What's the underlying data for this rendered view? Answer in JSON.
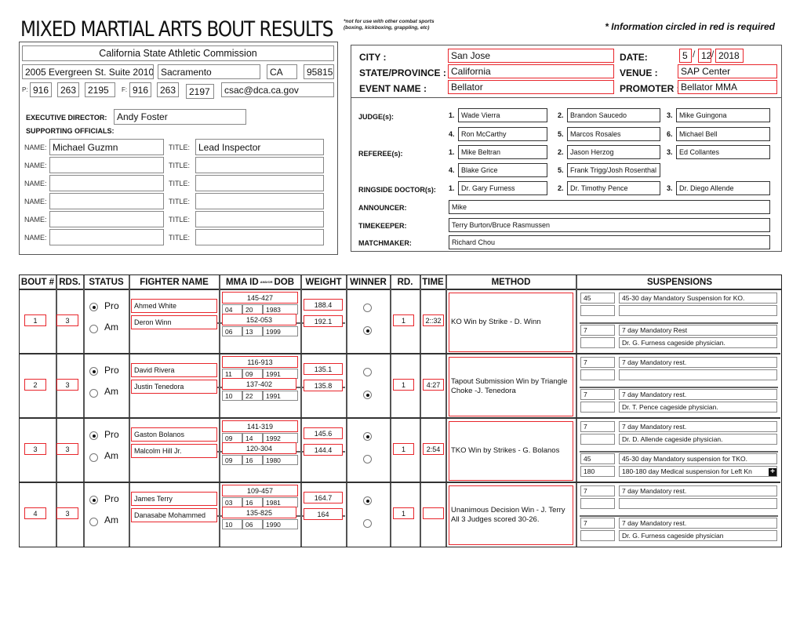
{
  "header": {
    "title": "MIXED MARTIAL ARTS BOUT RESULTS",
    "note_line1": "*not for use with other combat sports",
    "note_line2": "(boxing, kickboxing, grappling, etc)",
    "required_note": "* Information circled in red is required"
  },
  "commission": {
    "name": "California State Athletic Commission",
    "address": "2005 Evergreen St. Suite 2010",
    "city": "Sacramento",
    "state": "CA",
    "zip": "95815",
    "phone_label": "P:",
    "phone": [
      "916",
      "263",
      "2195"
    ],
    "fax_label": "F:",
    "fax": [
      "916",
      "263",
      "2197"
    ],
    "email": "csac@dca.ca.gov"
  },
  "event": {
    "city_label": "CITY :",
    "city": "San Jose",
    "state_label": "STATE/PROVINCE :",
    "state": "California",
    "event_name_label": "EVENT NAME :",
    "event_name": "Bellator",
    "date_label": "DATE:",
    "date_month": "5",
    "date_day": "12",
    "date_year": "2018",
    "date_sep": "/",
    "venue_label": "VENUE :",
    "venue": "SAP Center",
    "promoter_label": "PROMOTER :",
    "promoter": "Bellator MMA"
  },
  "officials": {
    "executive_director_label": "EXECUTIVE DIRECTOR:",
    "executive_director": "Andy Foster",
    "supporting_label": "SUPPORTING OFFICIALS:",
    "name_label": "NAME:",
    "title_label": "TITLE:",
    "rows": [
      {
        "name": "Michael Guzmn",
        "title": "Lead Inspector"
      },
      {
        "name": "",
        "title": ""
      },
      {
        "name": "",
        "title": ""
      },
      {
        "name": "",
        "title": ""
      },
      {
        "name": "",
        "title": ""
      },
      {
        "name": "",
        "title": ""
      }
    ]
  },
  "staff": {
    "judges_label": "JUDGE(s):",
    "judges": [
      "Wade Vierra",
      "Brandon Saucedo",
      "Mike Guingona",
      "Ron McCarthy",
      "Marcos Rosales",
      "Michael Bell"
    ],
    "referees_label": "REFEREE(s):",
    "referees": [
      "Mike Beltran",
      "Jason Herzog",
      "Ed Collantes",
      "Blake Grice",
      "Frank Trigg/Josh Rosenthal"
    ],
    "doctors_label": "RINGSIDE DOCTOR(s):",
    "doctors": [
      "Dr. Gary Furness",
      "Dr. Timothy Pence",
      "Dr. Diego Allende"
    ],
    "announcer_label": "ANNOUNCER:",
    "announcer": "Mike",
    "timekeeper_label": "TIMEKEEPER:",
    "timekeeper": "Terry Burton/Bruce Rasmussen",
    "matchmaker_label": "MATCHMAKER:",
    "matchmaker": "Richard Chou",
    "numbers": [
      "1.",
      "2.",
      "3.",
      "4.",
      "5.",
      "6."
    ]
  },
  "table": {
    "headers": {
      "bout": "BOUT #",
      "rds": "RDS.",
      "status": "STATUS",
      "fighter": "FIGHTER NAME",
      "mma_id": "MMA ID",
      "andor": "AND/OR",
      "dob": "DOB",
      "weight": "WEIGHT",
      "winner": "WINNER",
      "rd": "RD.",
      "time": "TIME",
      "method": "METHOD",
      "suspensions": "SUSPENSIONS"
    },
    "status_pro": "Pro",
    "status_am": "Am"
  },
  "bouts": [
    {
      "bout": "1",
      "rounds": "3",
      "status": "Pro",
      "round": "1",
      "time": "2::32",
      "method_line1": "KO Win by Strike - D. Winn",
      "method_line2": "",
      "fighters": [
        {
          "name": "Ahmed White",
          "mma_id": "145-427",
          "dob_m": "04",
          "dob_d": "20",
          "dob_y": "1983",
          "weight": "188.4",
          "winner": false,
          "susp": [
            {
              "days": "45",
              "text": "45-30 day Mandatory Suspension for KO."
            },
            {
              "days": "",
              "text": ""
            }
          ]
        },
        {
          "name": "Deron Winn",
          "mma_id": "152-053",
          "dob_m": "06",
          "dob_d": "13",
          "dob_y": "1999",
          "weight": "192.1",
          "winner": true,
          "susp": [
            {
              "days": "7",
              "text": "7 day Mandatory Rest"
            },
            {
              "days": "",
              "text": "Dr. G. Furness  cageside physician."
            }
          ]
        }
      ]
    },
    {
      "bout": "2",
      "rounds": "3",
      "status": "Pro",
      "round": "1",
      "time": "4:27",
      "method_line1": "Tapout Submission Win by Triangle",
      "method_line2": "Choke  -J. Tenedora",
      "fighters": [
        {
          "name": "David Rivera",
          "mma_id": "116-913",
          "dob_m": "11",
          "dob_d": "09",
          "dob_y": "1991",
          "weight": "135.1",
          "winner": false,
          "susp": [
            {
              "days": "7",
              "text": "7 day Mandatory rest."
            },
            {
              "days": "",
              "text": ""
            }
          ]
        },
        {
          "name": "Justin Tenedora",
          "mma_id": "137-402",
          "dob_m": "10",
          "dob_d": "22",
          "dob_y": "1991",
          "weight": "135.8",
          "winner": true,
          "susp": [
            {
              "days": "7",
              "text": "7 day Mandatory rest."
            },
            {
              "days": "",
              "text": "Dr. T. Pence cageside physician."
            }
          ]
        }
      ]
    },
    {
      "bout": "3",
      "rounds": "3",
      "status": "Pro",
      "round": "1",
      "time": "2:54",
      "method_line1": "TKO Win by Strikes - G. Bolanos",
      "method_line2": "",
      "fighters": [
        {
          "name": "Gaston Bolanos",
          "mma_id": "141-319",
          "dob_m": "09",
          "dob_d": "14",
          "dob_y": "1992",
          "weight": "145.6",
          "winner": true,
          "susp": [
            {
              "days": "7",
              "text": "7 day Mandatory rest."
            },
            {
              "days": "",
              "text": "Dr. D. Allende cageside physician."
            }
          ]
        },
        {
          "name": "Malcolm Hill Jr.",
          "mma_id": "120-304",
          "dob_m": "09",
          "dob_d": "16",
          "dob_y": "1980",
          "weight": "144.4",
          "winner": false,
          "susp": [
            {
              "days": "45",
              "text": "45-30 day Mandatory suspension for TKO."
            },
            {
              "days": "180",
              "text": "180-180 day Medical suspension for Left Kn"
            }
          ]
        }
      ]
    },
    {
      "bout": "4",
      "rounds": "3",
      "status": "Pro",
      "round": "1",
      "time": "",
      "method_line1": "Unanimous Decision Win - J. Terry",
      "method_line2": "All 3 Judges scored 30-26.",
      "fighters": [
        {
          "name": "James Terry",
          "mma_id": "109-457",
          "dob_m": "03",
          "dob_d": "16",
          "dob_y": "1981",
          "weight": "164.7",
          "winner": true,
          "susp": [
            {
              "days": "7",
              "text": "7 day Mandatory rest."
            },
            {
              "days": "",
              "text": ""
            }
          ]
        },
        {
          "name": "Danasabe Mohammed",
          "mma_id": "135-825",
          "dob_m": "10",
          "dob_d": "06",
          "dob_y": "1990",
          "weight": "164",
          "winner": false,
          "susp": [
            {
              "days": "7",
              "text": "7 day Mandatory rest."
            },
            {
              "days": "",
              "text": "Dr. G. Furness cageside physician"
            }
          ]
        }
      ]
    }
  ],
  "colors": {
    "required_red": "#e8262c",
    "field_gray": "#888888"
  },
  "icons": {
    "expand": "+"
  }
}
